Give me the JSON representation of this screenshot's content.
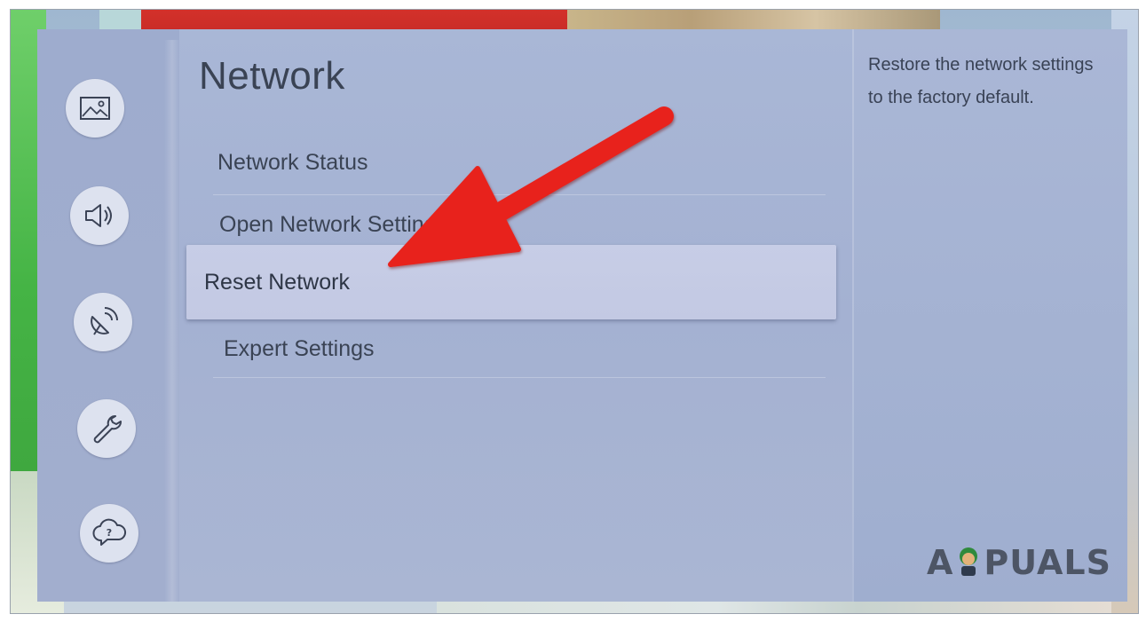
{
  "sidebar": {
    "items": [
      {
        "icon": "picture-icon"
      },
      {
        "icon": "sound-icon"
      },
      {
        "icon": "broadcast-icon"
      },
      {
        "icon": "wrench-icon"
      },
      {
        "icon": "support-icon"
      }
    ]
  },
  "main": {
    "title": "Network",
    "items": [
      {
        "label": "Network Status"
      },
      {
        "label": "Open Network Settings"
      },
      {
        "label": "Reset Network",
        "selected": true
      },
      {
        "label": "Expert Settings"
      }
    ]
  },
  "description": {
    "text": "Restore the network settings to the factory default."
  },
  "annotation": {
    "arrow_color": "#e8221c",
    "points_to": "Reset Network"
  },
  "watermark": {
    "text": "APPUALS"
  },
  "colors": {
    "panel": "#a6b3d3",
    "selected_row": "#c6cce5",
    "text": "#3a4354"
  }
}
